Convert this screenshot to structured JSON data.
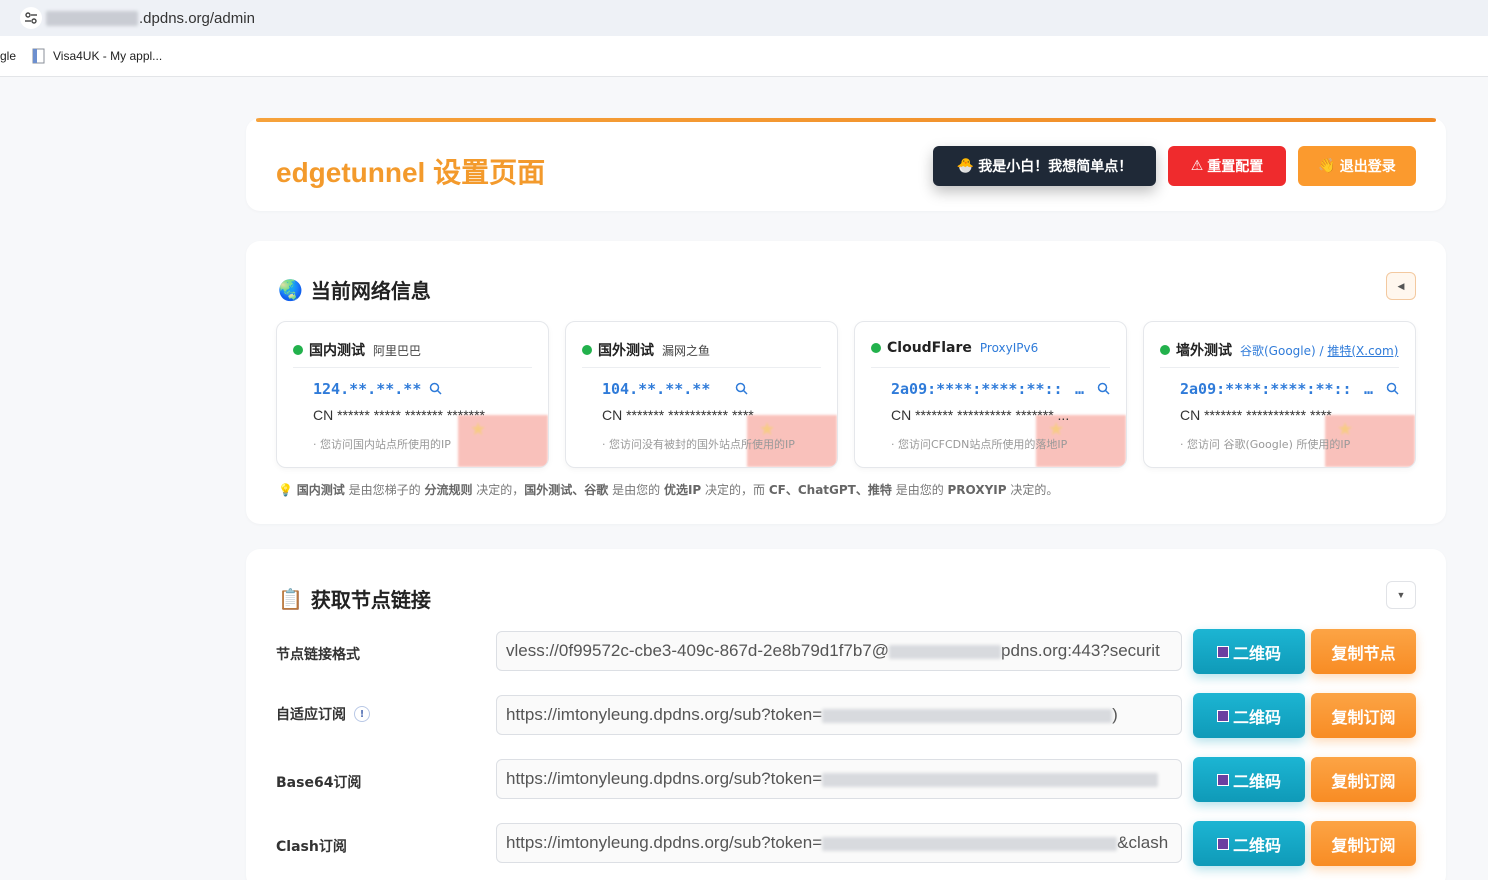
{
  "browser": {
    "url_visible": ".dpdns.org/admin",
    "bookmarks": [
      {
        "label": "gle"
      },
      {
        "label": "Visa4UK - My appl..."
      }
    ]
  },
  "header": {
    "title": "edgetunnel 设置页面",
    "buttons": {
      "simple": "我是小白！我想简单点！",
      "reset": "重置配置",
      "logout": "退出登录"
    }
  },
  "network": {
    "title": "当前网络信息",
    "boxes": [
      {
        "name": "国内测试",
        "sub": "阿里巴巴",
        "ip": "124.**.**.**",
        "geo": "CN ****** ***** ******* *******",
        "desc": "· 您访问国内站点所使用的IP"
      },
      {
        "name": "国外测试",
        "sub": "漏网之鱼",
        "ip": "104.**.**.**",
        "geo": "CN ******* *********** ****",
        "desc": "· 您访问没有被封的国外站点所使用的IP"
      },
      {
        "name": "CloudFlare",
        "sub": "ProxyIPv6",
        "ip": "2a09:****:****:**::",
        "ellipsis": "…",
        "geo": "CN ******* ********** ******* ...",
        "desc": "· 您访问CFCDN站点所使用的落地IP"
      },
      {
        "name": "墙外测试",
        "sub": "谷歌(Google) / ",
        "sub_link": "推特(X.com)",
        "ip": "2a09:****:****:**::",
        "ellipsis": "…",
        "geo": "CN ******* *********** ****",
        "desc": "· 您访问 谷歌(Google) 所使用的IP"
      }
    ],
    "note": {
      "p1": "国内测试",
      "t1": " 是由您梯子的 ",
      "p2": "分流规则",
      "t2": " 决定的，",
      "p3": "国外测试、谷歌",
      "t3": " 是由您的 ",
      "p4": "优选IP",
      "t4": " 决定的，而 ",
      "p5": "CF、ChatGPT、推特",
      "t5": " 是由您的 ",
      "p6": "PROXYIP",
      "t6": " 决定的。"
    }
  },
  "subscription": {
    "title": "获取节点链接",
    "rows": [
      {
        "label": "节点链接格式",
        "prefix": "vless://0f99572c-cbe3-409c-867d-2e8b79d1f7b7@",
        "suffix": "pdns.org:443?securit",
        "qr": "二维码",
        "copy": "复制节点"
      },
      {
        "label": "自适应订阅",
        "prefix": "https://imtonyleung.dpdns.org/sub?token=",
        "suffix": ")",
        "qr": "二维码",
        "copy": "复制订阅"
      },
      {
        "label": "Base64订阅",
        "prefix": "https://imtonyleung.dpdns.org/sub?token=",
        "suffix": "",
        "qr": "二维码",
        "copy": "复制订阅"
      },
      {
        "label": "Clash订阅",
        "prefix": "https://imtonyleung.dpdns.org/sub?token=",
        "suffix": "&clash",
        "qr": "二维码",
        "copy": "复制订阅"
      }
    ]
  }
}
